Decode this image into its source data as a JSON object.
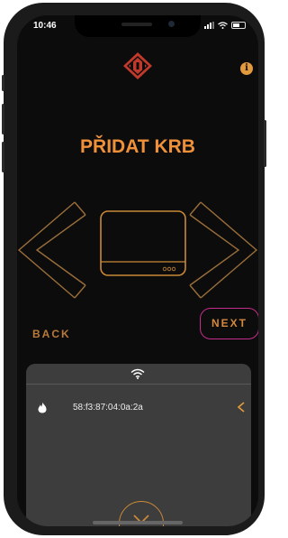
{
  "status_bar": {
    "time": "10:46"
  },
  "header": {
    "logo_icon": "dru-logo-icon",
    "info_icon": "info-icon",
    "info_glyph": "i"
  },
  "main": {
    "title": "PŘIDAT KRB",
    "device_icon": "fireplace-device-icon"
  },
  "nav": {
    "back_label": "BACK",
    "next_label": "NEXT"
  },
  "sheet": {
    "header_icon": "wifi-icon",
    "devices": [
      {
        "icon": "flame-icon",
        "mac": "58:f3:87:04:0a:2a",
        "action_icon": "chevron-left-icon"
      }
    ],
    "collapse_icon": "chevron-down-icon"
  },
  "colors": {
    "accent": "#f0913a",
    "accent_dark": "#b97a3a",
    "highlight": "#c52d8c",
    "logo_red": "#c0392b",
    "screen_bg": "#0c0c0c",
    "sheet_bg": "#3d3d3d"
  }
}
